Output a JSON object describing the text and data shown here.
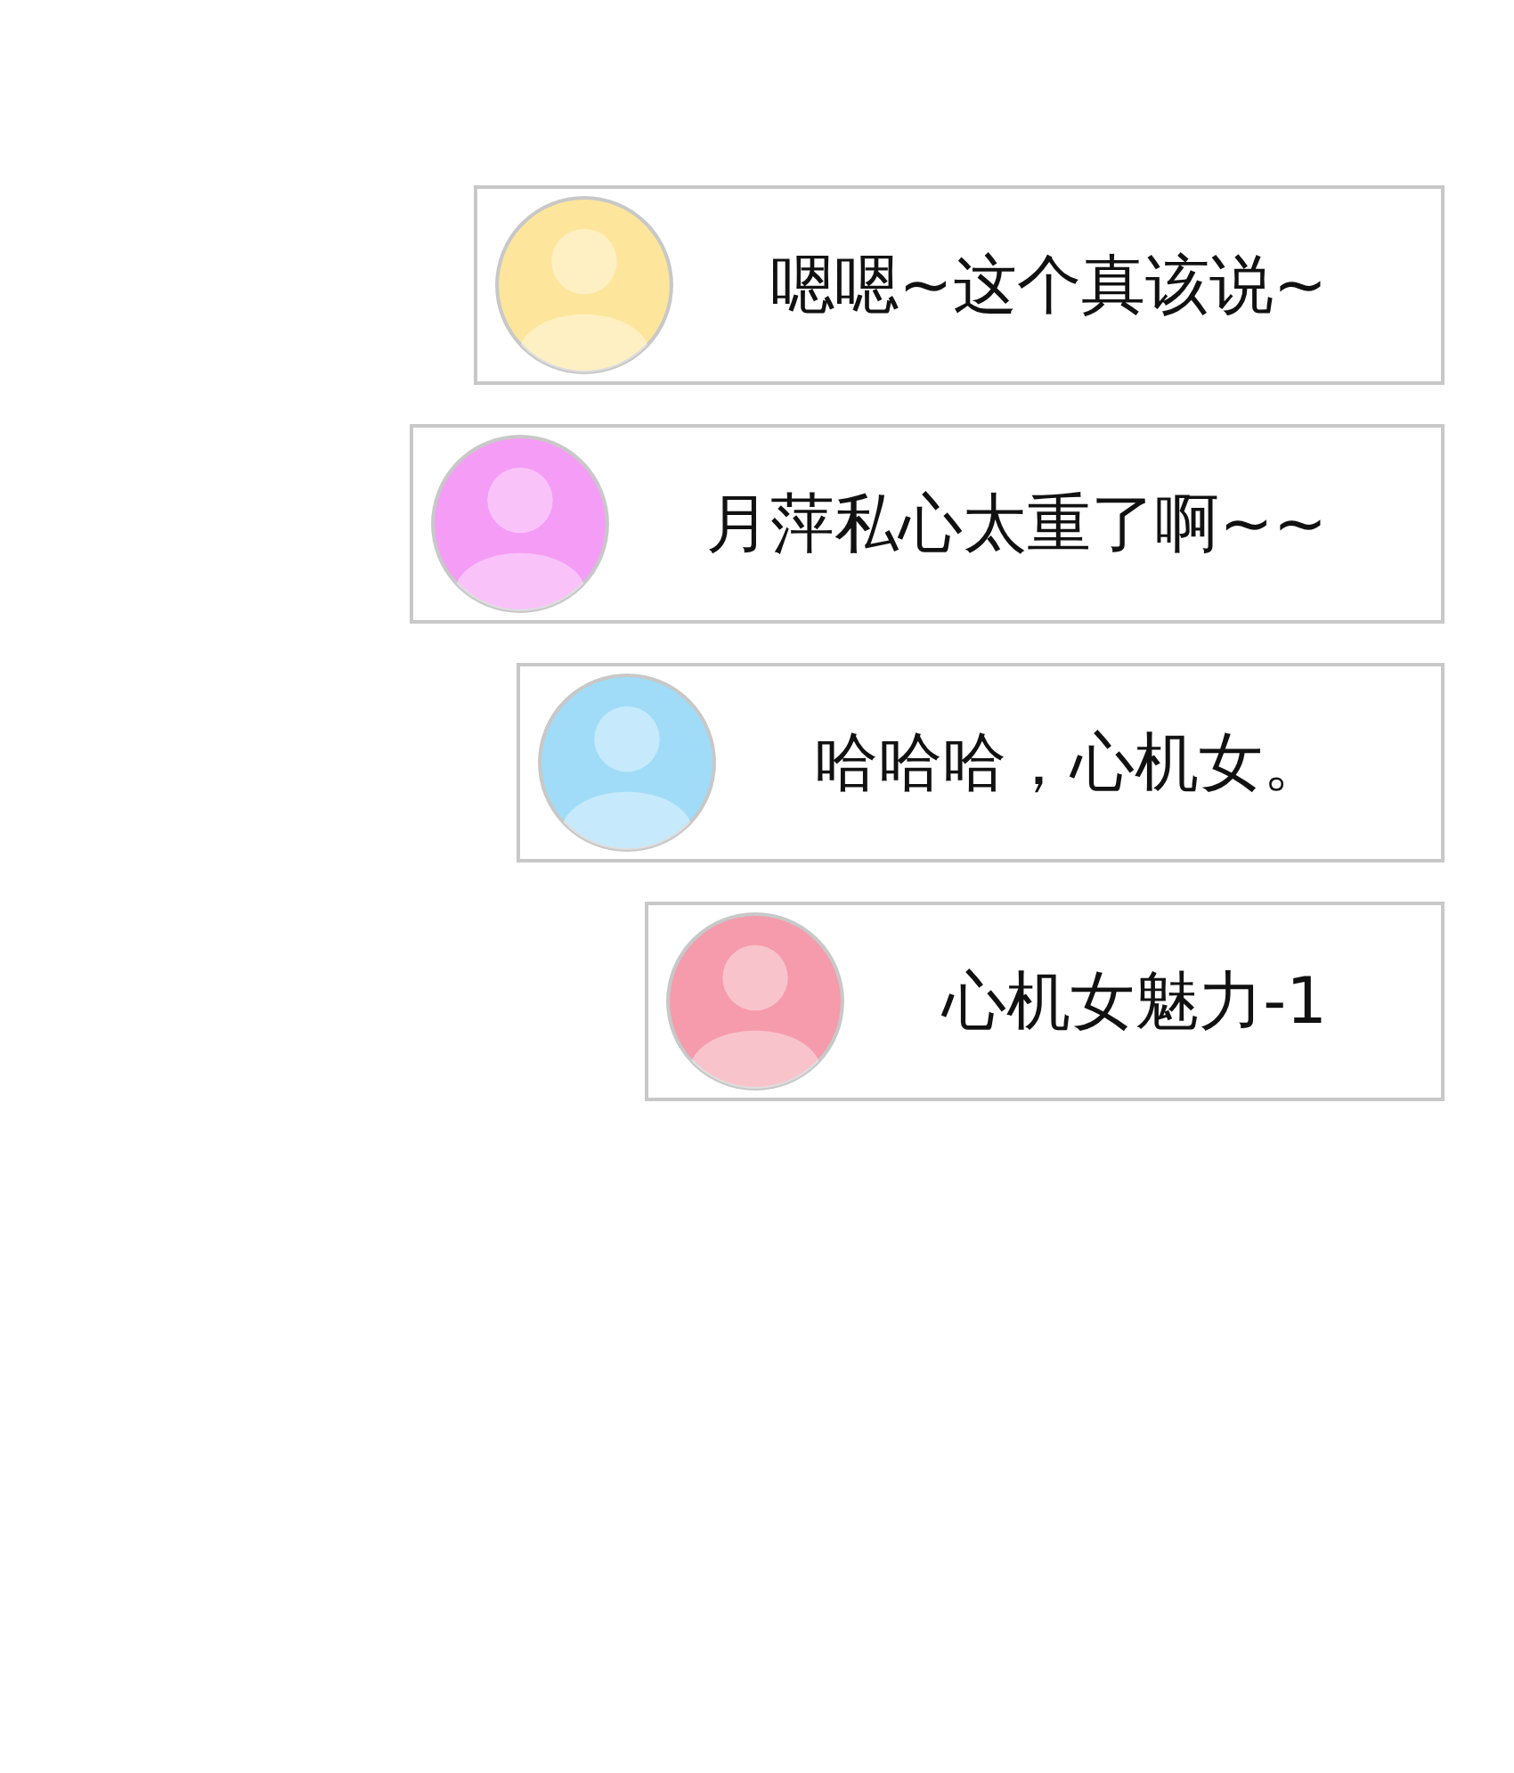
{
  "comments": [
    {
      "text": "嗯嗯~这个真该说~",
      "color": "#fde69b"
    },
    {
      "text": "月萍私心太重了啊~~",
      "color": "#f59cf6"
    },
    {
      "text": "哈哈哈，心机女。",
      "color": "#a0dcf8"
    },
    {
      "text": "心机女魅力-1",
      "color": "#f59bab"
    }
  ]
}
